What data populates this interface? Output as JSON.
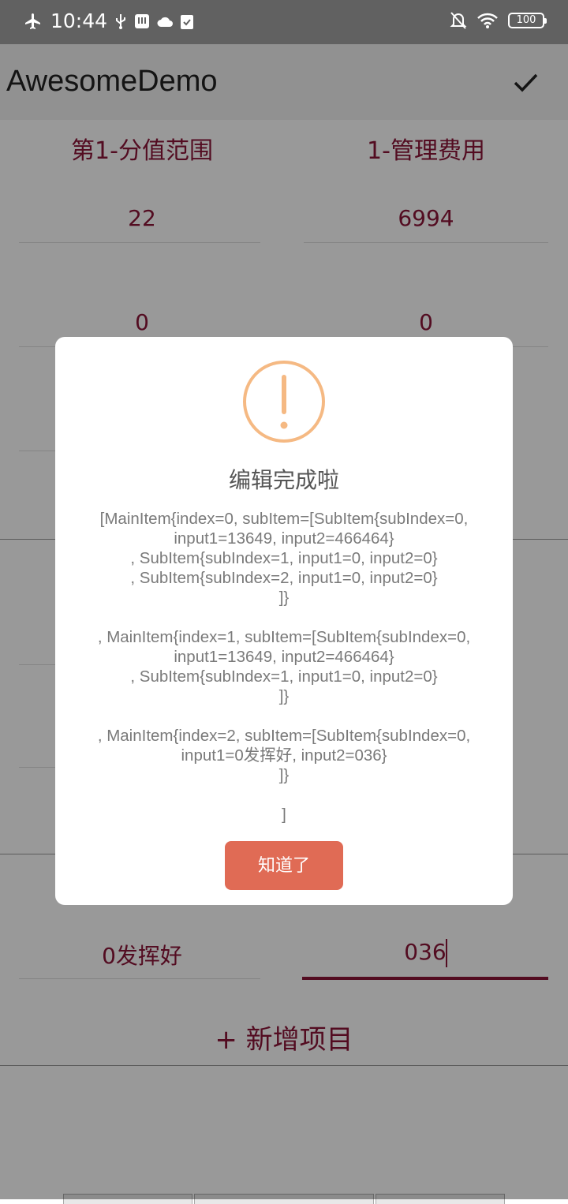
{
  "status_bar": {
    "time": "10:44",
    "battery": "100"
  },
  "app_bar": {
    "title": "AwesomeDemo"
  },
  "table": {
    "headers": [
      "第1-分值范围",
      "1-管理费用"
    ],
    "rows": [
      [
        "22",
        "6994"
      ],
      [
        "0",
        "0"
      ]
    ],
    "last_row": [
      "0发挥好",
      "036"
    ]
  },
  "add_button": {
    "label": "+ 新增项目"
  },
  "dialog": {
    "title": "编辑完成啦",
    "lines": [
      "[MainItem{index=0, subItem=[SubItem{subIndex=0,",
      "input1=13649, input2=466464}",
      ", SubItem{subIndex=1, input1=0, input2=0}",
      ", SubItem{subIndex=2, input1=0, input2=0}",
      "]}",
      "",
      ", MainItem{index=1, subItem=[SubItem{subIndex=0,",
      "input1=13649, input2=466464}",
      ", SubItem{subIndex=1, input1=0, input2=0}",
      "]}",
      "",
      ", MainItem{index=2, subItem=[SubItem{subIndex=0,",
      "input1=0发挥好, input2=036}",
      "]}",
      "",
      "]"
    ],
    "button_label": "知道了"
  },
  "colors": {
    "accent": "#8a1538",
    "button": "#e06b55",
    "warning": "#f5b983"
  }
}
